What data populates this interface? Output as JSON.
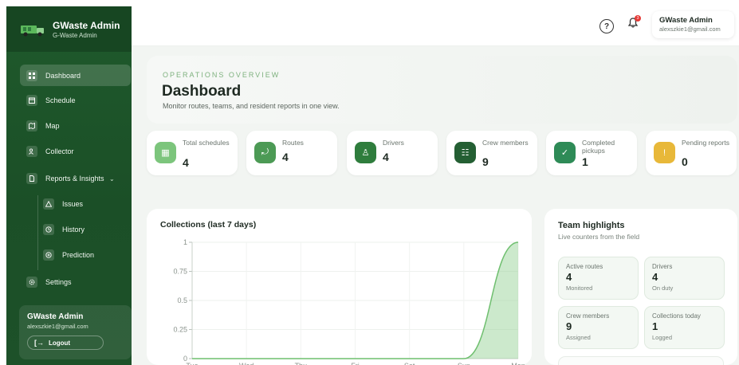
{
  "brand": {
    "name": "GWaste Admin",
    "subtitle": "G-Waste Admin"
  },
  "sidebar": {
    "items": [
      {
        "label": "Dashboard",
        "icon": "grid-icon",
        "active": true
      },
      {
        "label": "Schedule",
        "icon": "calendar-icon"
      },
      {
        "label": "Map",
        "icon": "map-icon"
      },
      {
        "label": "Collector",
        "icon": "users-icon"
      },
      {
        "label": "Reports & Insights",
        "icon": "file-icon",
        "expanded": true
      }
    ],
    "subitems": [
      {
        "label": "Issues",
        "icon": "warning-icon"
      },
      {
        "label": "History",
        "icon": "history-icon"
      },
      {
        "label": "Prediction",
        "icon": "prediction-icon"
      }
    ],
    "settings": {
      "label": "Settings",
      "icon": "gear-icon"
    },
    "user": {
      "name": "GWaste Admin",
      "email": "alexszkie1@gmail.com",
      "logout_label": "Logout"
    }
  },
  "topbar": {
    "help_glyph": "?",
    "notification_count": "3",
    "user": {
      "name": "GWaste Admin",
      "email": "alexszkie1@gmail.com"
    }
  },
  "hero": {
    "eyebrow": "OPERATIONS OVERVIEW",
    "title": "Dashboard",
    "description": "Monitor routes, teams, and resident reports in one view."
  },
  "stats": [
    {
      "label": "Total schedules",
      "value": "4",
      "color": "#7cc57c",
      "icon": "calendar-icon"
    },
    {
      "label": "Routes",
      "value": "4",
      "color": "#4c9a55",
      "icon": "route-icon"
    },
    {
      "label": "Drivers",
      "value": "4",
      "color": "#2f7d3d",
      "icon": "driver-icon"
    },
    {
      "label": "Crew members",
      "value": "9",
      "color": "#245f33",
      "icon": "crew-icon"
    },
    {
      "label": "Completed pickups",
      "value": "1",
      "color": "#2e8b57",
      "icon": "check-icon"
    },
    {
      "label": "Pending reports",
      "value": "0",
      "color": "#e8b839",
      "icon": "alert-icon"
    }
  ],
  "collections": {
    "title": "Collections (last 7 days)"
  },
  "chart_data": {
    "type": "area",
    "title": "Collections (last 7 days)",
    "categories": [
      "Tue",
      "Wed",
      "Thu",
      "Fri",
      "Sat",
      "Sun",
      "Mon"
    ],
    "values": [
      0,
      0,
      0,
      0,
      0,
      0,
      1
    ],
    "yticks": [
      "0",
      "0.25",
      "0.5",
      "0.75",
      "1"
    ],
    "ylim": [
      0,
      1
    ],
    "grid": true,
    "color": "#8fcf8f"
  },
  "team": {
    "title": "Team highlights",
    "subtitle": "Live counters from the field",
    "tiles": [
      {
        "label": "Active routes",
        "value": "4",
        "sub": "Monitored"
      },
      {
        "label": "Drivers",
        "value": "4",
        "sub": "On duty"
      },
      {
        "label": "Crew members",
        "value": "9",
        "sub": "Assigned"
      },
      {
        "label": "Collections today",
        "value": "1",
        "sub": "Logged"
      }
    ]
  }
}
